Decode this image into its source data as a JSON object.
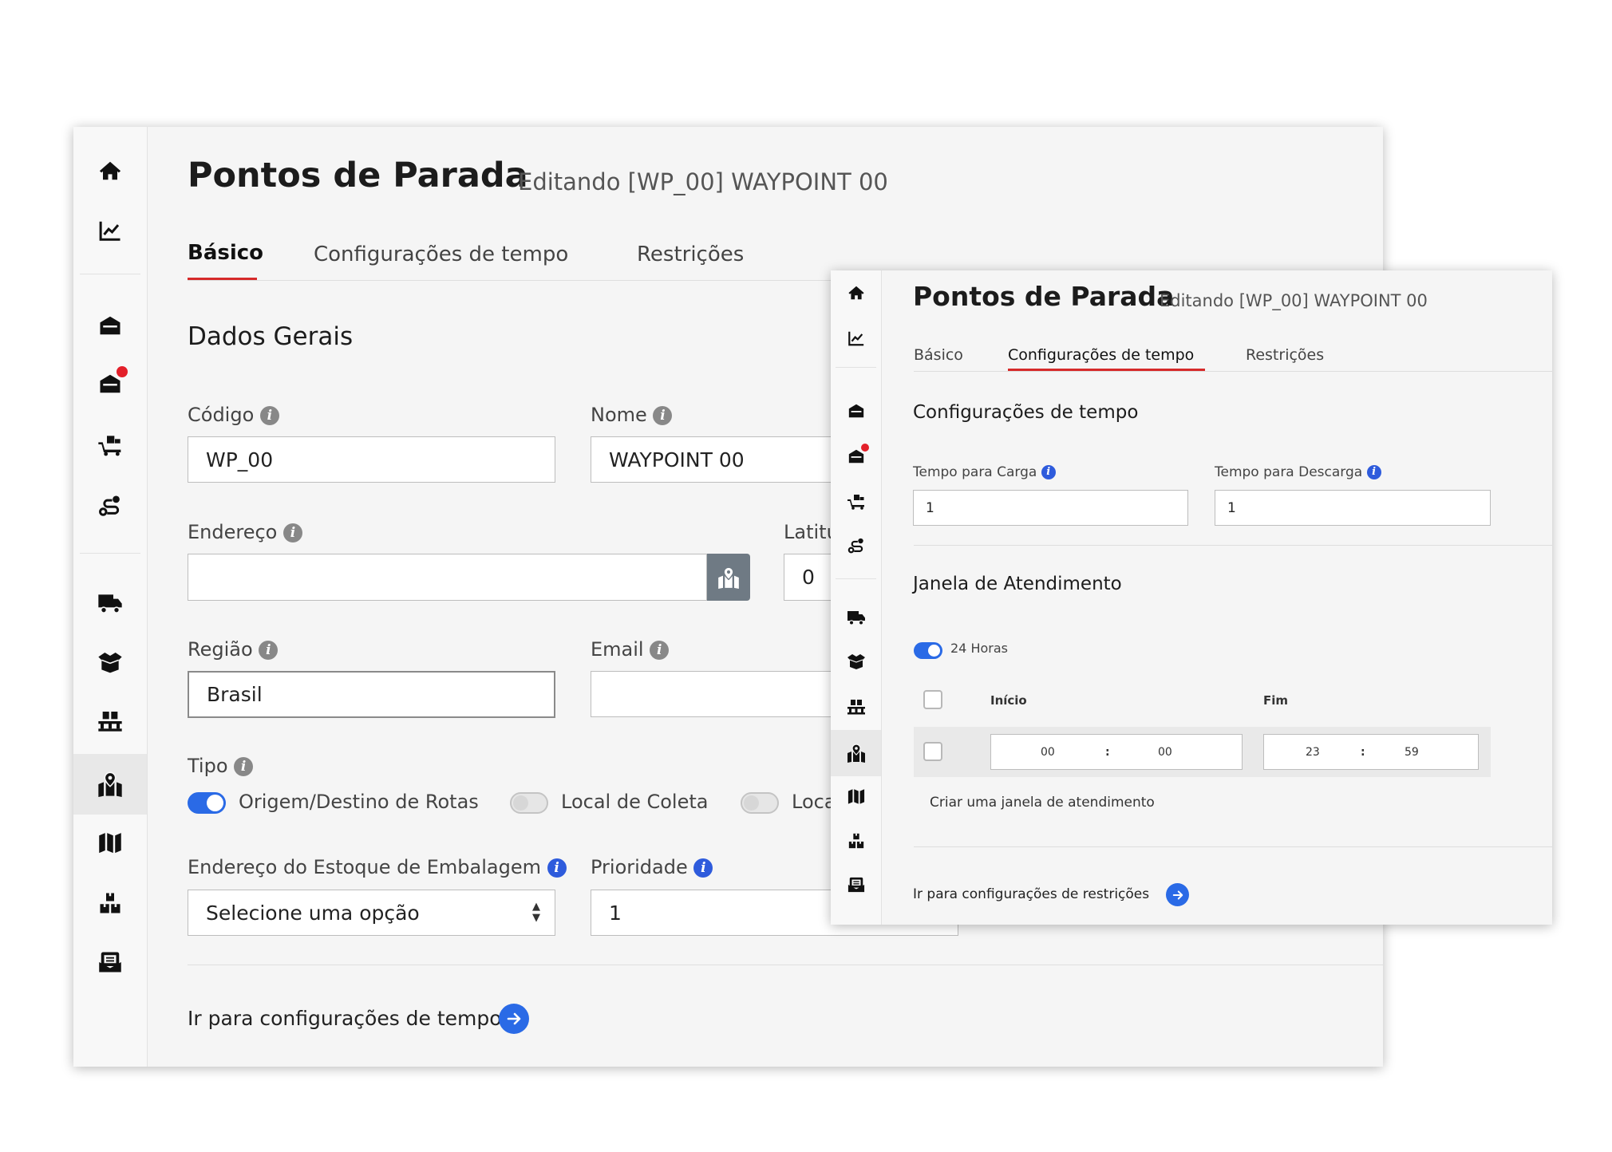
{
  "sidebar": {
    "icons": [
      "home-icon",
      "chart-line-icon",
      "warehouse-icon",
      "warehouse-alert-icon",
      "truck-loading-icon",
      "route-icon",
      "truck-icon",
      "box-open-icon",
      "pallet-icon",
      "map-marked-icon",
      "map-icon",
      "boxes-icon",
      "mail-bulk-icon"
    ]
  },
  "colors": {
    "accent": "#d62a2a",
    "primary": "#2a6ae6",
    "notification": "#e3202a"
  },
  "back": {
    "title": "Pontos de Parada",
    "subtitle": "Editando [WP_00] WAYPOINT 00",
    "tabs": [
      "Básico",
      "Configurações de tempo",
      "Restrições"
    ],
    "active_tab": "Básico",
    "section_title": "Dados Gerais",
    "fields": {
      "codigo": {
        "label": "Código",
        "value": "WP_00"
      },
      "nome": {
        "label": "Nome",
        "value": "WAYPOINT 00"
      },
      "endereco": {
        "label": "Endereço",
        "value": ""
      },
      "latitude": {
        "label": "Latitu",
        "value": "0"
      },
      "regiao": {
        "label": "Região",
        "value": "Brasil"
      },
      "email": {
        "label": "Email",
        "value": ""
      },
      "tipo": {
        "label": "Tipo"
      },
      "estoque": {
        "label": "Endereço do Estoque de Embalagem",
        "value": "Selecione uma opção"
      },
      "prioridade": {
        "label": "Prioridade",
        "value": "1"
      }
    },
    "tipo_options": [
      {
        "label": "Origem/Destino de Rotas",
        "checked": true
      },
      {
        "label": "Local de Coleta",
        "checked": false
      },
      {
        "label": "Loca",
        "checked": false
      }
    ],
    "next_link": "Ir para configurações de tempo"
  },
  "front": {
    "title": "Pontos de Parada",
    "subtitle": "Editando [WP_00] WAYPOINT 00",
    "tabs": [
      "Básico",
      "Configurações de tempo",
      "Restrições"
    ],
    "active_tab": "Configurações de tempo",
    "section_title": "Configurações de tempo",
    "carga": {
      "label": "Tempo para Carga",
      "value": "1"
    },
    "descarga": {
      "label": "Tempo para Descarga",
      "value": "1"
    },
    "janela_title": "Janela de Atendimento",
    "toggle_24h": {
      "label": "24 Horas",
      "checked": true
    },
    "col_inicio": "Início",
    "col_fim": "Fim",
    "inicio": {
      "hour": "00",
      "sep": ":",
      "minute": "00"
    },
    "fim": {
      "hour": "23",
      "sep": ":",
      "minute": "59"
    },
    "create_link": "Criar uma janela de atendimento",
    "next_link": "Ir para configurações de restrições"
  }
}
